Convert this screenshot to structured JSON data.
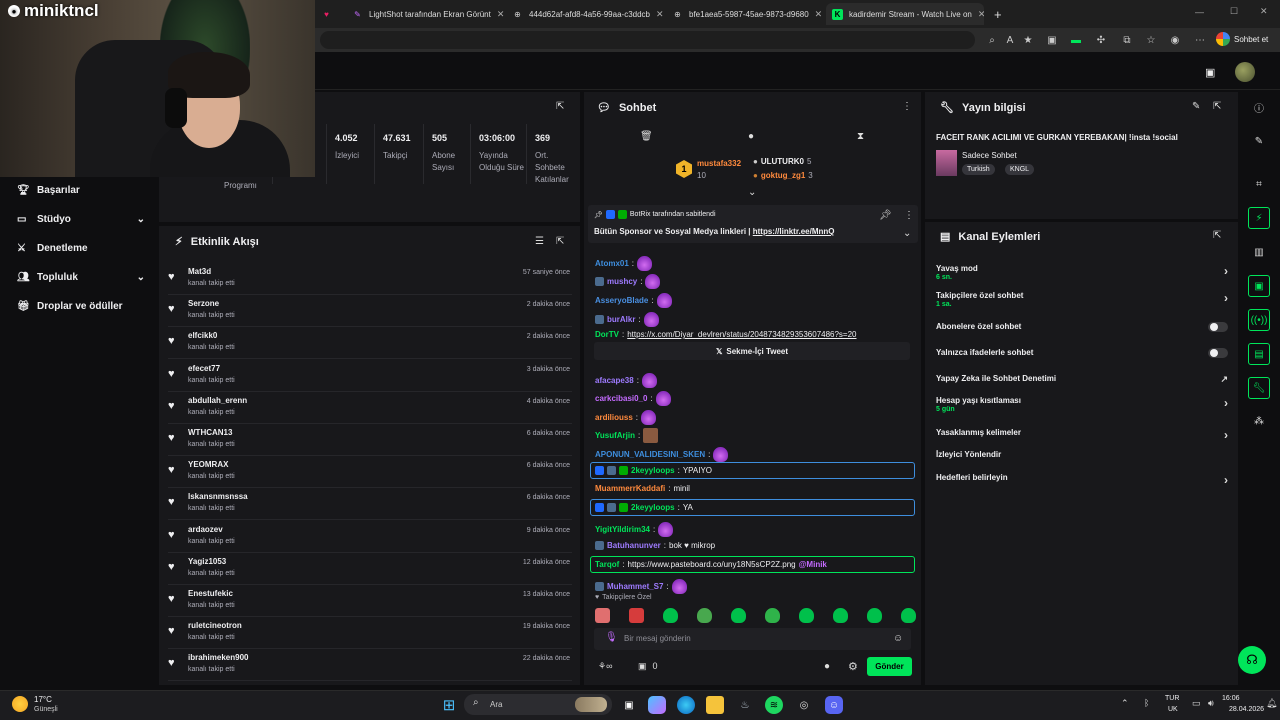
{
  "browser": {
    "tabs": [
      {
        "label": "LightShot tarafından Ekran Görünt"
      },
      {
        "label": "444d62af-afd8-4a56-99aa-c3ddcb"
      },
      {
        "label": "bfe1aea5-5987-45ae-9873-d9680"
      },
      {
        "label": "kadirdemir Stream - Watch Live on"
      }
    ],
    "new_tab": "+",
    "chat_button": "Sohbet et"
  },
  "webcam": {
    "title": "miniktncl"
  },
  "left_nav": {
    "items": [
      {
        "label": "Başarılar",
        "icon": "trophy-icon"
      },
      {
        "label": "Stüdyo",
        "icon": "video-icon",
        "expand": "⌄"
      },
      {
        "label": "Denetleme",
        "icon": "sword-icon"
      },
      {
        "label": "Topluluk",
        "icon": "people-icon",
        "expand": "⌄"
      },
      {
        "label": "Droplar ve ödüller",
        "icon": "gift-icon"
      }
    ]
  },
  "stats": {
    "partial_label": "Programı",
    "items": [
      {
        "value": "4.052",
        "label": "İzleyici"
      },
      {
        "value": "47.631",
        "label": "Takipçi"
      },
      {
        "value": "505",
        "label": "Abone Sayısı"
      },
      {
        "value": "03:06:00",
        "label": "Yayında Olduğu Süre"
      },
      {
        "value": "369",
        "label": "Ort. Sohbete Katılanlar"
      }
    ]
  },
  "activity": {
    "title": "Etkinlik Akışı",
    "items": [
      {
        "name": "Mat3d",
        "sub": "kanalı takip etti",
        "time": "57 saniye önce"
      },
      {
        "name": "Serzone",
        "sub": "kanalı takip etti",
        "time": "2 dakika önce"
      },
      {
        "name": "elfcikk0",
        "sub": "kanalı takip etti",
        "time": "2 dakika önce"
      },
      {
        "name": "efecet77",
        "sub": "kanalı takip etti",
        "time": "3 dakika önce"
      },
      {
        "name": "abdullah_erenn",
        "sub": "kanalı takip etti",
        "time": "4 dakika önce"
      },
      {
        "name": "WTHCAN13",
        "sub": "kanalı takip etti",
        "time": "6 dakika önce"
      },
      {
        "name": "YEOMRAX",
        "sub": "kanalı takip etti",
        "time": "6 dakika önce"
      },
      {
        "name": "lskansnmsnssa",
        "sub": "kanalı takip etti",
        "time": "6 dakika önce"
      },
      {
        "name": "ardaozev",
        "sub": "kanalı takip etti",
        "time": "9 dakika önce"
      },
      {
        "name": "Yagiz1053",
        "sub": "kanalı takip etti",
        "time": "12 dakika önce"
      },
      {
        "name": "Enestufekic",
        "sub": "kanalı takip etti",
        "time": "13 dakika önce"
      },
      {
        "name": "ruletcineotron",
        "sub": "kanalı takip etti",
        "time": "19 dakika önce"
      },
      {
        "name": "ibrahimeken900",
        "sub": "kanalı takip etti",
        "time": "22 dakika önce"
      }
    ]
  },
  "chat": {
    "title": "Sohbet",
    "leaderboard": {
      "first": {
        "name": "mustafa332",
        "count": "10",
        "rank": "1"
      },
      "second": {
        "name": "ULUTURK0",
        "count": "5"
      },
      "third": {
        "name": "goktug_zg1",
        "count": "3"
      }
    },
    "pinned": {
      "by": "BotRix tarafından sabitlendi",
      "text": "Bütün Sponsor ve Sosyal Medya linkleri | ",
      "link": "https://linktr.ee/MnnQ"
    },
    "messages": [
      {
        "user": "Atomx01",
        "color": "#3e8ede",
        "text": "",
        "emote": true
      },
      {
        "user": "mushcy",
        "color": "#9e7bff",
        "text": "",
        "emote": true
      },
      {
        "user": "AsseryoBlade",
        "color": "#4a90e2",
        "text": "",
        "emote": true
      },
      {
        "user": "burAlkr",
        "color": "#9e7bff",
        "text": "",
        "emote": true
      },
      {
        "user": "DorTV",
        "color": "#00e55a",
        "text": "https://x.com/Diyar_devlren/status/2048734829353607486?s=20",
        "link": true
      },
      {
        "user": "afacape38",
        "color": "#9e7bff",
        "text": "",
        "emote": true
      },
      {
        "user": "carkcibasi0_0",
        "color": "#c46bff",
        "text": "",
        "emote": true
      },
      {
        "user": "ardiliouss",
        "color": "#ff8a3d",
        "text": "",
        "emote": true
      },
      {
        "user": "YusufArjin",
        "color": "#00e55a",
        "text": "",
        "emote": false
      },
      {
        "user": "APONUN_VALIDESINI_SKEN",
        "color": "#3e8ede",
        "text": "",
        "emote": true
      },
      {
        "user": "2keyyloops",
        "color": "#00e55a",
        "text": "YPAIYO"
      },
      {
        "user": "MuammerrKaddafi",
        "color": "#ff8a3d",
        "text": "minil"
      },
      {
        "user": "2keyyloops",
        "color": "#00e55a",
        "text": "YA"
      },
      {
        "user": "YigitYildirim34",
        "color": "#00e55a",
        "text": "",
        "emote": true
      },
      {
        "user": "Batuhanunver",
        "color": "#9e7bff",
        "text": "bok ♥ mikrop"
      },
      {
        "user": "Tarqof",
        "color": "#00e55a",
        "text": "https://www.pasteboard.co/uny18N5sCP2Z.png",
        "mention": "@Minik"
      },
      {
        "user": "Muhammet_S7",
        "color": "#9e7bff",
        "text": "",
        "emote": true
      }
    ],
    "tweet_button": "Sekme-İçi Tweet",
    "followers_only": "Takipçilere Özel",
    "input_placeholder": "Bir mesaj gönderin",
    "points": "0",
    "send_button": "Gönder"
  },
  "stream_info": {
    "title": "Yayın bilgisi",
    "stream_title": "FACEIT RANK ACILIMI VE GURKAN YEREBAKAN| !insta !social",
    "category": "Sadece Sohbet",
    "tags": [
      "Turkish",
      "KNGL"
    ]
  },
  "channel_actions": {
    "title": "Kanal Eylemleri",
    "items": [
      {
        "label": "Yavaş mod",
        "sub": "6 sn.",
        "control": "chevron"
      },
      {
        "label": "Takipçilere özel sohbet",
        "sub": "1 sa.",
        "control": "chevron"
      },
      {
        "label": "Abonelere özel sohbet",
        "sub": "",
        "control": "toggle"
      },
      {
        "label": "Yalnızca ifadelerle sohbet",
        "sub": "",
        "control": "toggle"
      },
      {
        "label": "Yapay Zeka ile Sohbet Denetimi",
        "sub": "",
        "control": "chart"
      },
      {
        "label": "Hesap yaşı kısıtlaması",
        "sub": "5 gün",
        "control": "chevron"
      },
      {
        "label": "Yasaklanmış kelimeler",
        "sub": "",
        "control": "chevron"
      },
      {
        "label": "İzleyici Yönlendir",
        "sub": "",
        "control": "none"
      },
      {
        "label": "Hedefleri belirleyin",
        "sub": "",
        "control": "chevron"
      }
    ]
  },
  "taskbar": {
    "weather_temp": "17°C",
    "weather_text": "Güneşli",
    "search": "Ara",
    "lang_top": "TUR",
    "lang_bottom": "UK",
    "time": "16:06",
    "date": "28.04.2026"
  },
  "colors": {
    "accent": "#00e55a",
    "bg": "#0e0e10",
    "panel": "#18181b"
  }
}
